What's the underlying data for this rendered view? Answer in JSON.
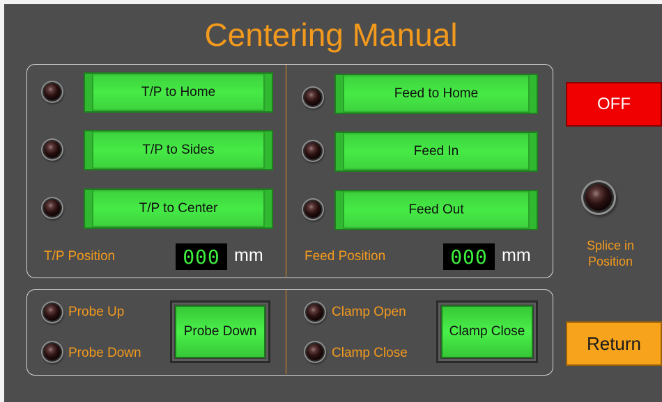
{
  "title": "Centering Manual",
  "tp": {
    "buttons": [
      {
        "label": "T/P to Home"
      },
      {
        "label": "T/P to Sides"
      },
      {
        "label": "T/P to Center"
      }
    ],
    "position_label": "T/P Position",
    "position_value": "000",
    "unit": "mm"
  },
  "feed": {
    "buttons": [
      {
        "label": "Feed to Home"
      },
      {
        "label": "Feed In"
      },
      {
        "label": "Feed Out"
      }
    ],
    "position_label": "Feed Position",
    "position_value": "000",
    "unit": "mm"
  },
  "probe": {
    "up_label": "Probe Up",
    "down_label": "Probe Down",
    "button_label": "Probe Down"
  },
  "clamp": {
    "open_label": "Clamp Open",
    "close_label": "Clamp Close",
    "button_label": "Clamp Close"
  },
  "off_button": "OFF",
  "splice": {
    "line1": "Splice in",
    "line2": "Position"
  },
  "return_button": "Return",
  "colors": {
    "background": "#4d4d4d",
    "accent_orange": "#f39a1d",
    "button_green": "#46ea46",
    "off_red": "#f00000",
    "return_orange": "#f7a41c",
    "digit_green": "#3df23d"
  }
}
